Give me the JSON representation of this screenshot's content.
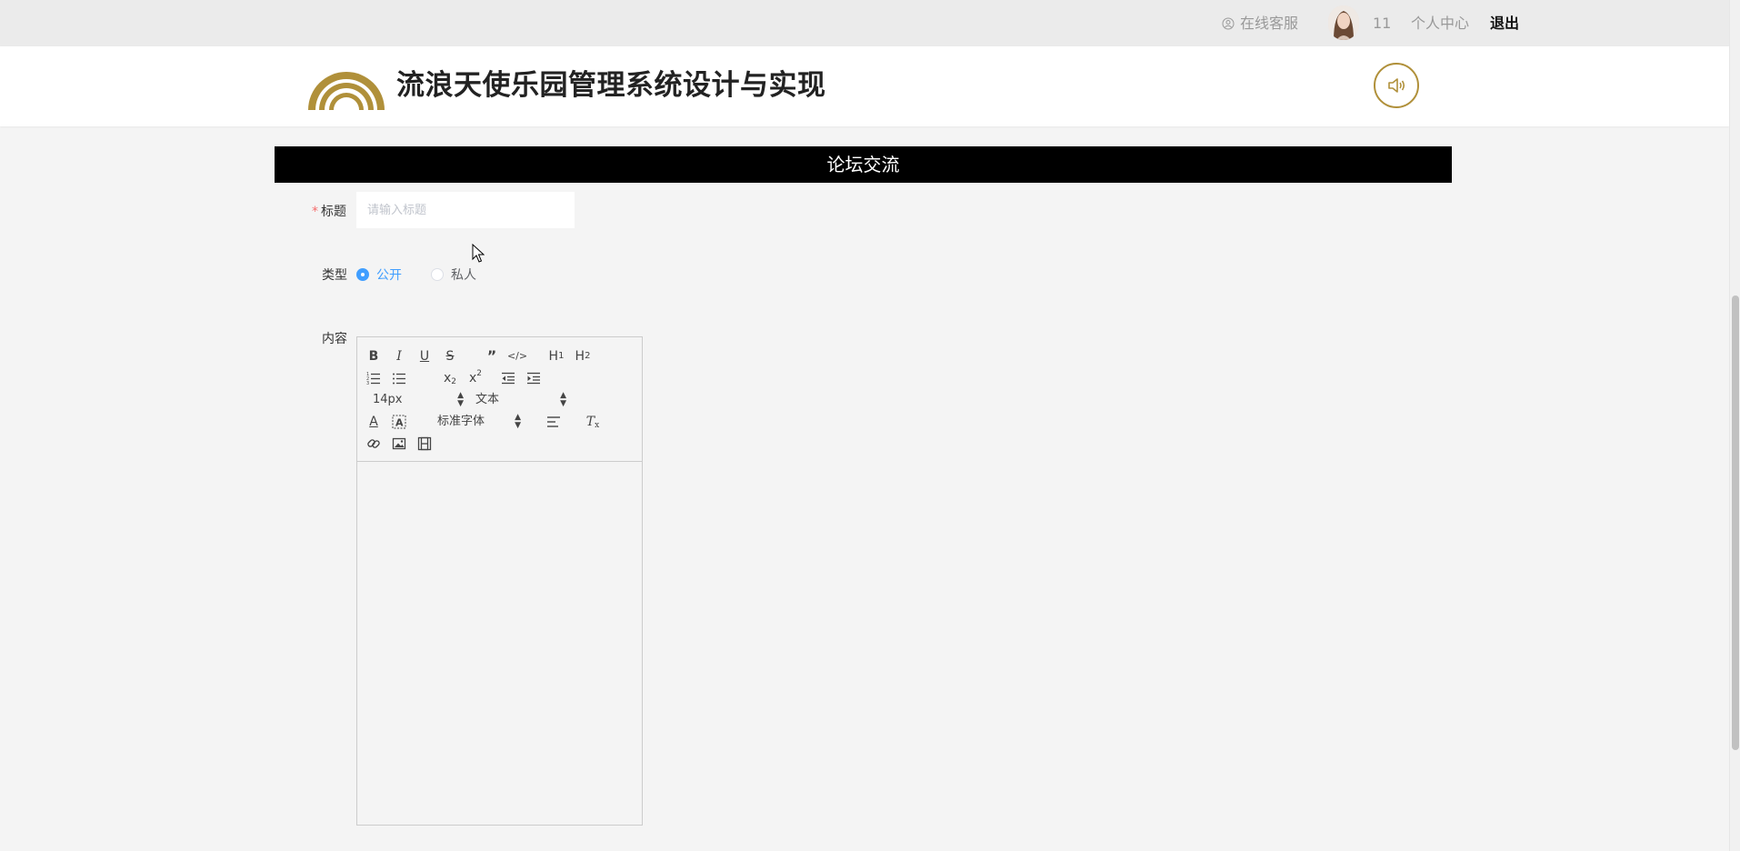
{
  "topbar": {
    "service_label": "在线客服",
    "username": "11",
    "personal_center": "个人中心",
    "logout": "退出"
  },
  "header": {
    "site_title": "流浪天使乐园管理系统设计与实现",
    "brand_color": "#b0903a"
  },
  "section": {
    "title": "论坛交流"
  },
  "form": {
    "title_label": "标题",
    "title_placeholder": "请输入标题",
    "title_value": "",
    "type_label": "类型",
    "type_options": [
      "公开",
      "私人"
    ],
    "type_selected": "公开",
    "content_label": "内容",
    "editor": {
      "font_size": "14px",
      "header_style": "文本",
      "font_family": "标准字体"
    }
  },
  "colors": {
    "accent": "#409eff",
    "required": "#f56c6c",
    "section_bg": "#000000"
  }
}
